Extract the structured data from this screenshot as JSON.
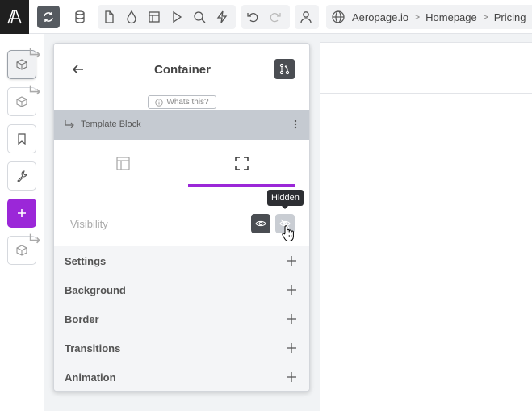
{
  "topbar": {
    "logo_icon": "aeropage-logo-icon",
    "groups": [
      [
        "sync-icon",
        "database-icon"
      ],
      [
        "file-icon",
        "drop-icon",
        "layout-icon",
        "play-icon",
        "search-icon",
        "bolt-icon"
      ],
      [
        "undo-icon",
        "redo-icon"
      ],
      [
        "user-icon"
      ]
    ],
    "breadcrumb": [
      "Aeropage.io",
      "Homepage",
      "Pricing"
    ],
    "breadcrumb_sep": ">"
  },
  "rail": {
    "items": [
      "cube-icon",
      "cube-icon",
      "bookmark-icon",
      "wrench-icon",
      "plus-icon",
      "cube-icon"
    ]
  },
  "panel": {
    "title": "Container",
    "whats_this": "Whats this?",
    "template_label": "Template Block",
    "tabs": [
      "layout-icon",
      "expand-icon"
    ],
    "active_tab": 1,
    "visibility_label": "Visibility",
    "tooltip": "Hidden",
    "sections": [
      "Settings",
      "Background",
      "Border",
      "Transitions",
      "Animation"
    ]
  },
  "colors": {
    "accent": "#9b27d8",
    "dark": "#4a4d52",
    "template_bar": "#c5cad1"
  }
}
